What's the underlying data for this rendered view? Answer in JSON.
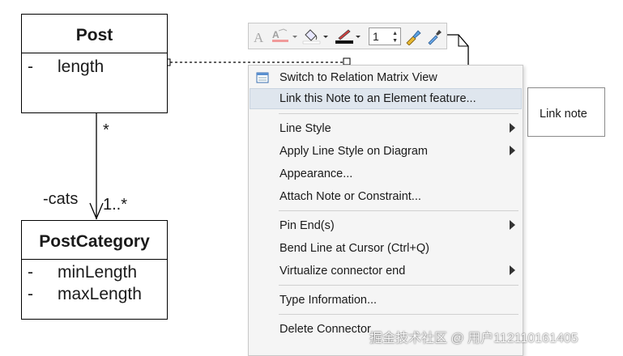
{
  "diagram": {
    "post": {
      "name": "Post",
      "attributes": [
        {
          "visibility": "-",
          "name": "length"
        }
      ]
    },
    "post_category": {
      "name": "PostCategory",
      "attributes": [
        {
          "visibility": "-",
          "name": "minLength"
        },
        {
          "visibility": "-",
          "name": "maxLength"
        }
      ]
    },
    "association": {
      "source_multiplicity": "*",
      "target_role": "-cats",
      "target_multiplicity": "1..*"
    },
    "note": {
      "text": "Link note"
    }
  },
  "toolbar": {
    "line_width_value": "1",
    "icons": [
      "font-icon",
      "font-color-icon",
      "fill-color-icon",
      "line-color-icon",
      "format-painter-icon",
      "eyedropper-icon"
    ]
  },
  "context_menu": {
    "items": [
      {
        "label": "Switch to Relation Matrix View",
        "icon": "matrix-view-icon"
      },
      {
        "label": "Link this Note to an Element feature...",
        "highlighted": true
      },
      {
        "label": "Line Style",
        "submenu": true
      },
      {
        "label": "Apply Line Style on Diagram",
        "submenu": true
      },
      {
        "label": "Appearance..."
      },
      {
        "label": "Attach Note or Constraint..."
      },
      {
        "label": "Pin End(s)",
        "submenu": true
      },
      {
        "label": "Bend Line at Cursor (Ctrl+Q)"
      },
      {
        "label": "Virtualize connector end",
        "submenu": true
      },
      {
        "label": "Type Information..."
      },
      {
        "label": "Delete Connector"
      }
    ]
  },
  "watermark": "掘金技术社区 @ 用户112110161405"
}
